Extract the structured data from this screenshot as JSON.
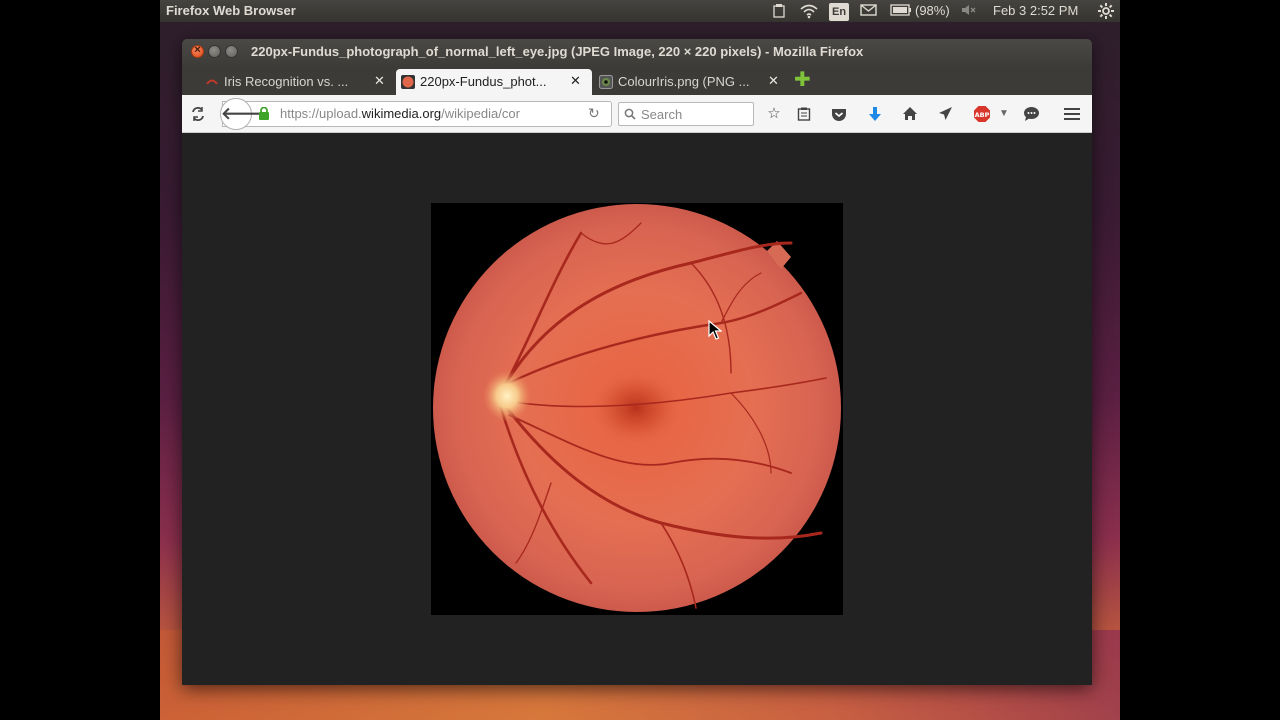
{
  "top_panel": {
    "app_name": "Firefox Web Browser",
    "keyboard_layout": "En",
    "battery": "(98%)",
    "datetime": "Feb  3  2:52 PM"
  },
  "window": {
    "title": "220px-Fundus_photograph_of_normal_left_eye.jpg (JPEG Image, 220 × 220 pixels) - Mozilla Firefox"
  },
  "tabs": [
    {
      "label": "Iris Recognition vs. ...",
      "active": false
    },
    {
      "label": "220px-Fundus_phot...",
      "active": true
    },
    {
      "label": "ColourIris.png (PNG ...",
      "active": false
    }
  ],
  "tab_close_glyph": "✕",
  "new_tab_glyph": "✚",
  "navbar": {
    "url_prefix": "https://upload.",
    "url_domain": "wikimedia.org",
    "url_rest": "/wikipedia/cor",
    "search_placeholder": "Search"
  },
  "colors": {
    "panel_bg": "#3c3b37",
    "close_button": "#df4a16",
    "content_bg": "#222222",
    "fundus_orange": "#e0664a",
    "new_tab_green": "#7ec339"
  },
  "icons": [
    "sync-icon",
    "back-arrow-icon",
    "lock-icon",
    "reload-icon",
    "search-icon",
    "bookmark-star-icon",
    "reading-list-icon",
    "pocket-icon",
    "download-arrow-icon",
    "home-icon",
    "send-icon",
    "adblock-icon",
    "chat-bubble-icon",
    "hamburger-menu-icon"
  ]
}
